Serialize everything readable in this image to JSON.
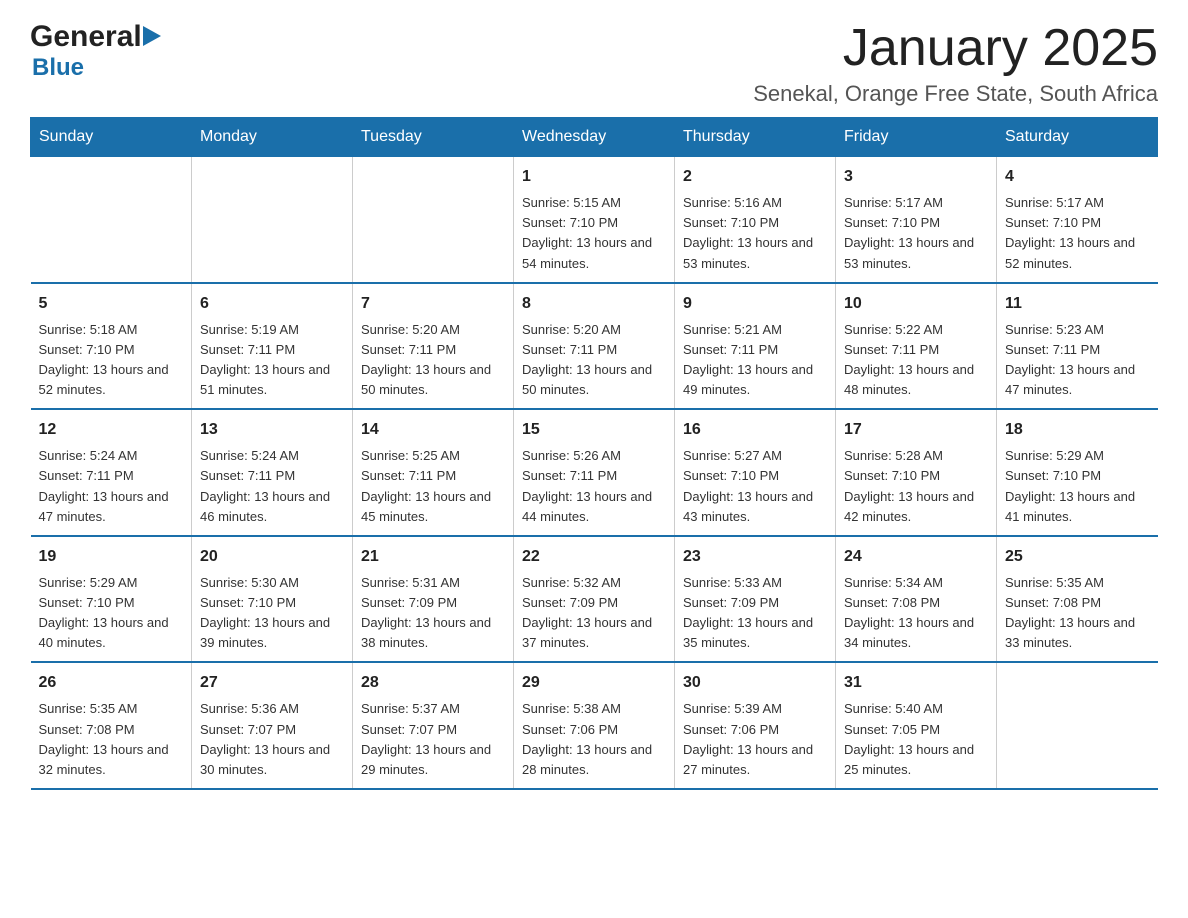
{
  "logo": {
    "general": "General",
    "triangle": "▶",
    "blue": "Blue"
  },
  "header": {
    "month": "January 2025",
    "location": "Senekal, Orange Free State, South Africa"
  },
  "days_of_week": [
    "Sunday",
    "Monday",
    "Tuesday",
    "Wednesday",
    "Thursday",
    "Friday",
    "Saturday"
  ],
  "weeks": [
    [
      {
        "day": "",
        "info": ""
      },
      {
        "day": "",
        "info": ""
      },
      {
        "day": "",
        "info": ""
      },
      {
        "day": "1",
        "info": "Sunrise: 5:15 AM\nSunset: 7:10 PM\nDaylight: 13 hours and 54 minutes."
      },
      {
        "day": "2",
        "info": "Sunrise: 5:16 AM\nSunset: 7:10 PM\nDaylight: 13 hours and 53 minutes."
      },
      {
        "day": "3",
        "info": "Sunrise: 5:17 AM\nSunset: 7:10 PM\nDaylight: 13 hours and 53 minutes."
      },
      {
        "day": "4",
        "info": "Sunrise: 5:17 AM\nSunset: 7:10 PM\nDaylight: 13 hours and 52 minutes."
      }
    ],
    [
      {
        "day": "5",
        "info": "Sunrise: 5:18 AM\nSunset: 7:10 PM\nDaylight: 13 hours and 52 minutes."
      },
      {
        "day": "6",
        "info": "Sunrise: 5:19 AM\nSunset: 7:11 PM\nDaylight: 13 hours and 51 minutes."
      },
      {
        "day": "7",
        "info": "Sunrise: 5:20 AM\nSunset: 7:11 PM\nDaylight: 13 hours and 50 minutes."
      },
      {
        "day": "8",
        "info": "Sunrise: 5:20 AM\nSunset: 7:11 PM\nDaylight: 13 hours and 50 minutes."
      },
      {
        "day": "9",
        "info": "Sunrise: 5:21 AM\nSunset: 7:11 PM\nDaylight: 13 hours and 49 minutes."
      },
      {
        "day": "10",
        "info": "Sunrise: 5:22 AM\nSunset: 7:11 PM\nDaylight: 13 hours and 48 minutes."
      },
      {
        "day": "11",
        "info": "Sunrise: 5:23 AM\nSunset: 7:11 PM\nDaylight: 13 hours and 47 minutes."
      }
    ],
    [
      {
        "day": "12",
        "info": "Sunrise: 5:24 AM\nSunset: 7:11 PM\nDaylight: 13 hours and 47 minutes."
      },
      {
        "day": "13",
        "info": "Sunrise: 5:24 AM\nSunset: 7:11 PM\nDaylight: 13 hours and 46 minutes."
      },
      {
        "day": "14",
        "info": "Sunrise: 5:25 AM\nSunset: 7:11 PM\nDaylight: 13 hours and 45 minutes."
      },
      {
        "day": "15",
        "info": "Sunrise: 5:26 AM\nSunset: 7:11 PM\nDaylight: 13 hours and 44 minutes."
      },
      {
        "day": "16",
        "info": "Sunrise: 5:27 AM\nSunset: 7:10 PM\nDaylight: 13 hours and 43 minutes."
      },
      {
        "day": "17",
        "info": "Sunrise: 5:28 AM\nSunset: 7:10 PM\nDaylight: 13 hours and 42 minutes."
      },
      {
        "day": "18",
        "info": "Sunrise: 5:29 AM\nSunset: 7:10 PM\nDaylight: 13 hours and 41 minutes."
      }
    ],
    [
      {
        "day": "19",
        "info": "Sunrise: 5:29 AM\nSunset: 7:10 PM\nDaylight: 13 hours and 40 minutes."
      },
      {
        "day": "20",
        "info": "Sunrise: 5:30 AM\nSunset: 7:10 PM\nDaylight: 13 hours and 39 minutes."
      },
      {
        "day": "21",
        "info": "Sunrise: 5:31 AM\nSunset: 7:09 PM\nDaylight: 13 hours and 38 minutes."
      },
      {
        "day": "22",
        "info": "Sunrise: 5:32 AM\nSunset: 7:09 PM\nDaylight: 13 hours and 37 minutes."
      },
      {
        "day": "23",
        "info": "Sunrise: 5:33 AM\nSunset: 7:09 PM\nDaylight: 13 hours and 35 minutes."
      },
      {
        "day": "24",
        "info": "Sunrise: 5:34 AM\nSunset: 7:08 PM\nDaylight: 13 hours and 34 minutes."
      },
      {
        "day": "25",
        "info": "Sunrise: 5:35 AM\nSunset: 7:08 PM\nDaylight: 13 hours and 33 minutes."
      }
    ],
    [
      {
        "day": "26",
        "info": "Sunrise: 5:35 AM\nSunset: 7:08 PM\nDaylight: 13 hours and 32 minutes."
      },
      {
        "day": "27",
        "info": "Sunrise: 5:36 AM\nSunset: 7:07 PM\nDaylight: 13 hours and 30 minutes."
      },
      {
        "day": "28",
        "info": "Sunrise: 5:37 AM\nSunset: 7:07 PM\nDaylight: 13 hours and 29 minutes."
      },
      {
        "day": "29",
        "info": "Sunrise: 5:38 AM\nSunset: 7:06 PM\nDaylight: 13 hours and 28 minutes."
      },
      {
        "day": "30",
        "info": "Sunrise: 5:39 AM\nSunset: 7:06 PM\nDaylight: 13 hours and 27 minutes."
      },
      {
        "day": "31",
        "info": "Sunrise: 5:40 AM\nSunset: 7:05 PM\nDaylight: 13 hours and 25 minutes."
      },
      {
        "day": "",
        "info": ""
      }
    ]
  ]
}
